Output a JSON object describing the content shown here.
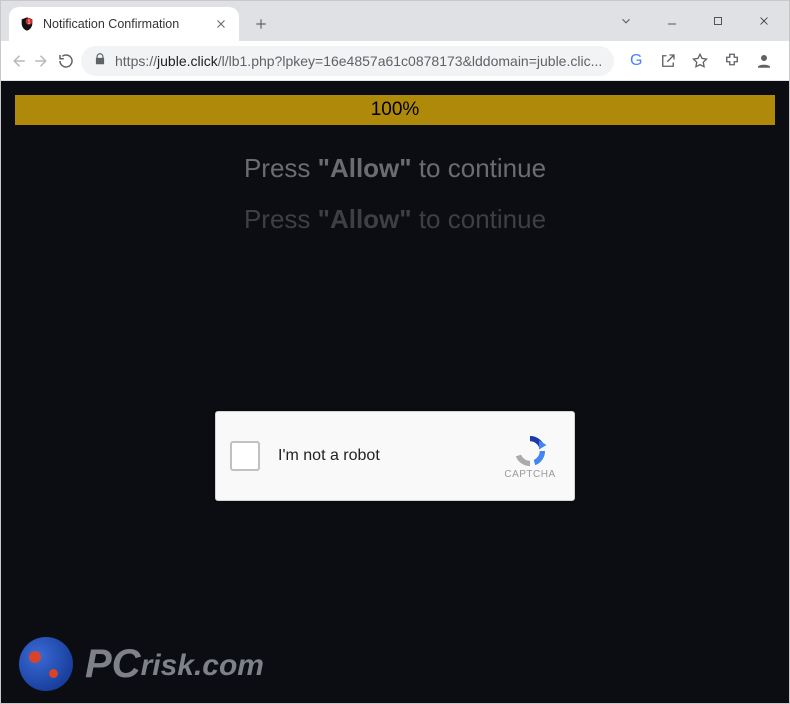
{
  "window": {
    "title": "Notification Confirmation"
  },
  "tab": {
    "title": "Notification Confirmation"
  },
  "address": {
    "scheme": "https://",
    "host": "juble.click",
    "path": "/l/lb1.php?lpkey=16e4857a61c0878173&lddomain=juble.clic..."
  },
  "page": {
    "progress_text": "100%",
    "press_prefix": "Press ",
    "press_bold": "\"Allow\"",
    "press_suffix": " to continue"
  },
  "captcha": {
    "label": "I'm not a robot",
    "brand": "CAPTCHA"
  },
  "watermark": {
    "text": "PCrisk.com"
  }
}
